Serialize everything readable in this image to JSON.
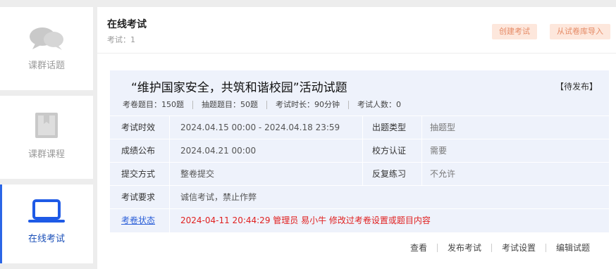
{
  "sidebar": {
    "items": [
      {
        "label": "课群话题",
        "icon": "chat-bubbles-icon",
        "active": false
      },
      {
        "label": "课群课程",
        "icon": "book-icon",
        "active": false
      },
      {
        "label": "在线考试",
        "icon": "laptop-icon",
        "active": true
      }
    ]
  },
  "header": {
    "title": "在线考试",
    "count_label": "考试：",
    "count_value": "1",
    "create_button": "创建考试",
    "import_button": "从试卷库导入"
  },
  "exam": {
    "title": "“维护国家安全，共筑和谐校园”活动试题",
    "status": "【待发布】",
    "stats": [
      "考卷题目：150题",
      "抽题题目：50题",
      "考试时长：90分钟",
      "考试人数：0"
    ],
    "rows": {
      "time_label": "考试时效",
      "time_value": "2024.04.15 00:00 - 2024.04.18 23:59",
      "type_label": "出题类型",
      "type_value": "抽题型",
      "publish_label": "成绩公布",
      "publish_value": "2024.04.21 00:00",
      "auth_label": "校方认证",
      "auth_value": "需要",
      "submit_label": "提交方式",
      "submit_value": "整卷提交",
      "practice_label": "反复练习",
      "practice_value": "不允许",
      "require_label": "考试要求",
      "require_value": "诚信考试，禁止作弊",
      "state_label": "考卷状态",
      "state_value": "2024-04-11 20:44:29 管理员 易小牛 修改过考卷设置或题目内容"
    },
    "actions": [
      "查看",
      "发布考试",
      "考试设置",
      "编辑试题"
    ]
  },
  "colors": {
    "accent": "#2b66e6",
    "card_bg": "#eef2fb",
    "warning_red": "#e02020",
    "button_bg": "#fde7dc",
    "button_text": "#e58a65"
  }
}
